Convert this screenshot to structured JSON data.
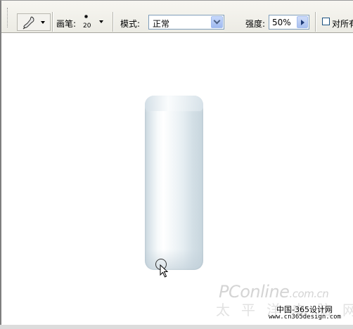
{
  "toolbar": {
    "brush_label": "画笔:",
    "brush_size": "20",
    "mode_label": "模式:",
    "mode_value": "正常",
    "strength_label": "强度:",
    "strength_value": "50%",
    "sample_all_label": "对所有"
  },
  "icons": {
    "tool_preset": "smudge-tool-icon",
    "mode_dropdown": "chevron-down-icon",
    "strength_popup": "triangle-right-icon",
    "cursor": "arrow-cursor-icon"
  },
  "watermark": {
    "brand": "PConline",
    "brand_suffix": ".com.cn",
    "brand_cn": "太平洋电脑网",
    "site": "中国-365设计网",
    "url": "www.cn365design.com"
  },
  "colors": {
    "toolbar_bg": "#ecebe4",
    "field_border": "#7f9db9",
    "glass_edge": "#c9d6de",
    "glass_highlight": "#ffffff"
  }
}
